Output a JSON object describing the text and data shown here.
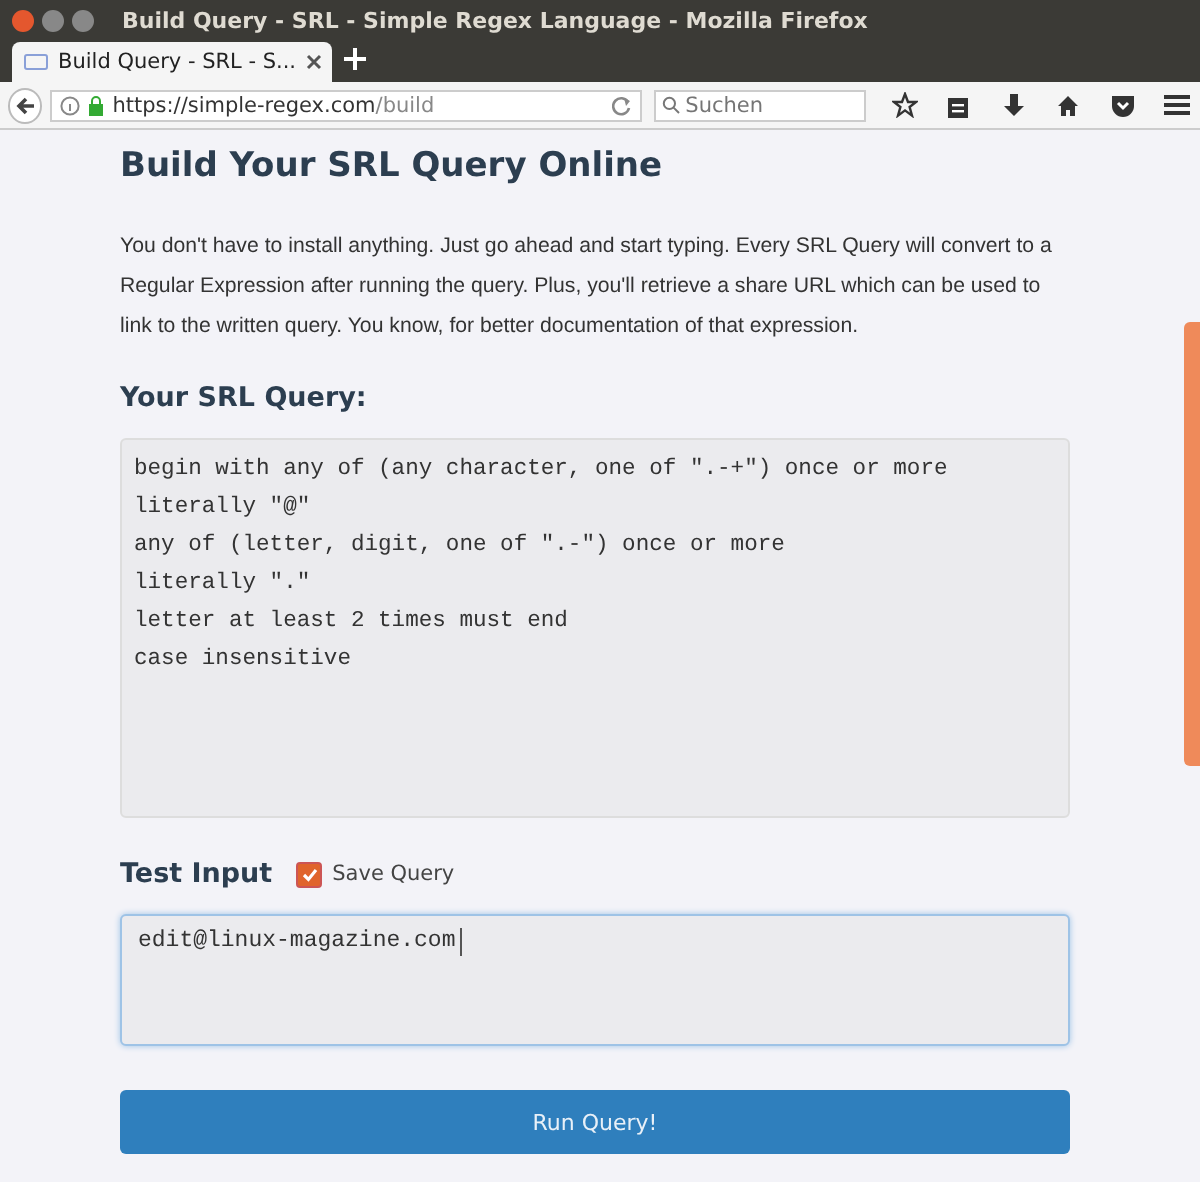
{
  "window": {
    "title": "Build Query - SRL - Simple Regex Language - Mozilla Firefox"
  },
  "tabs": [
    {
      "label": "Build Query - SRL - S...",
      "selected": true
    }
  ],
  "address_bar": {
    "url_host": "https://simple-regex.com",
    "url_path": "/build"
  },
  "search": {
    "placeholder": "Suchen"
  },
  "page": {
    "heading": "Build Your SRL Query Online",
    "intro": "You don't have to install anything. Just go ahead and start typing. Every SRL Query will convert to a Regular Expression after running the query. Plus, you'll retrieve a share URL which can be used to link to the written query. You know, for better documentation of that expression.",
    "query_label": "Your SRL Query:",
    "query_lines": [
      "begin with any of (any character, one of \".-+\") once or more",
      "literally \"@\"",
      "any of (letter, digit, one of \".-\") once or more",
      "literally \".\"",
      "letter at least 2 times must end",
      "case insensitive"
    ],
    "test_label": "Test Input",
    "save_query": {
      "label": "Save Query",
      "checked": true
    },
    "test_value": "edit@linux-magazine.com",
    "run_button": "Run Query!"
  }
}
